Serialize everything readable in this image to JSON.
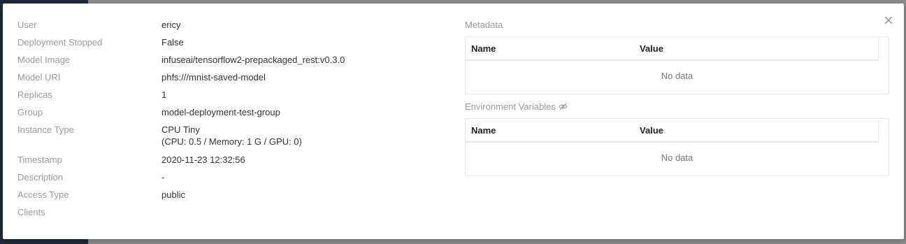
{
  "details": [
    {
      "label": "User",
      "value": "ericy"
    },
    {
      "label": "Deployment Stopped",
      "value": "False"
    },
    {
      "label": "Model Image",
      "value": "infuseai/tensorflow2-prepackaged_rest:v0.3.0"
    },
    {
      "label": "Model URI",
      "value": "phfs:///mnist-saved-model"
    },
    {
      "label": "Replicas",
      "value": "1"
    },
    {
      "label": "Group",
      "value": "model-deployment-test-group"
    },
    {
      "label": "Instance Type",
      "value": "CPU Tiny",
      "value2": "(CPU: 0.5 / Memory: 1 G / GPU: 0)"
    },
    {
      "label": "Timestamp",
      "value": "2020-11-23 12:32:56"
    },
    {
      "label": "Description",
      "value": "-"
    },
    {
      "label": "Access Type",
      "value": "public"
    },
    {
      "label": "Clients",
      "value": ""
    }
  ],
  "metadata": {
    "title": "Metadata",
    "columns": [
      "Name",
      "Value"
    ],
    "empty_text": "No data"
  },
  "env_vars": {
    "title": "Environment Variables",
    "columns": [
      "Name",
      "Value"
    ],
    "empty_text": "No data",
    "icon": "eye-invisible-icon"
  },
  "close_icon": "close-icon"
}
